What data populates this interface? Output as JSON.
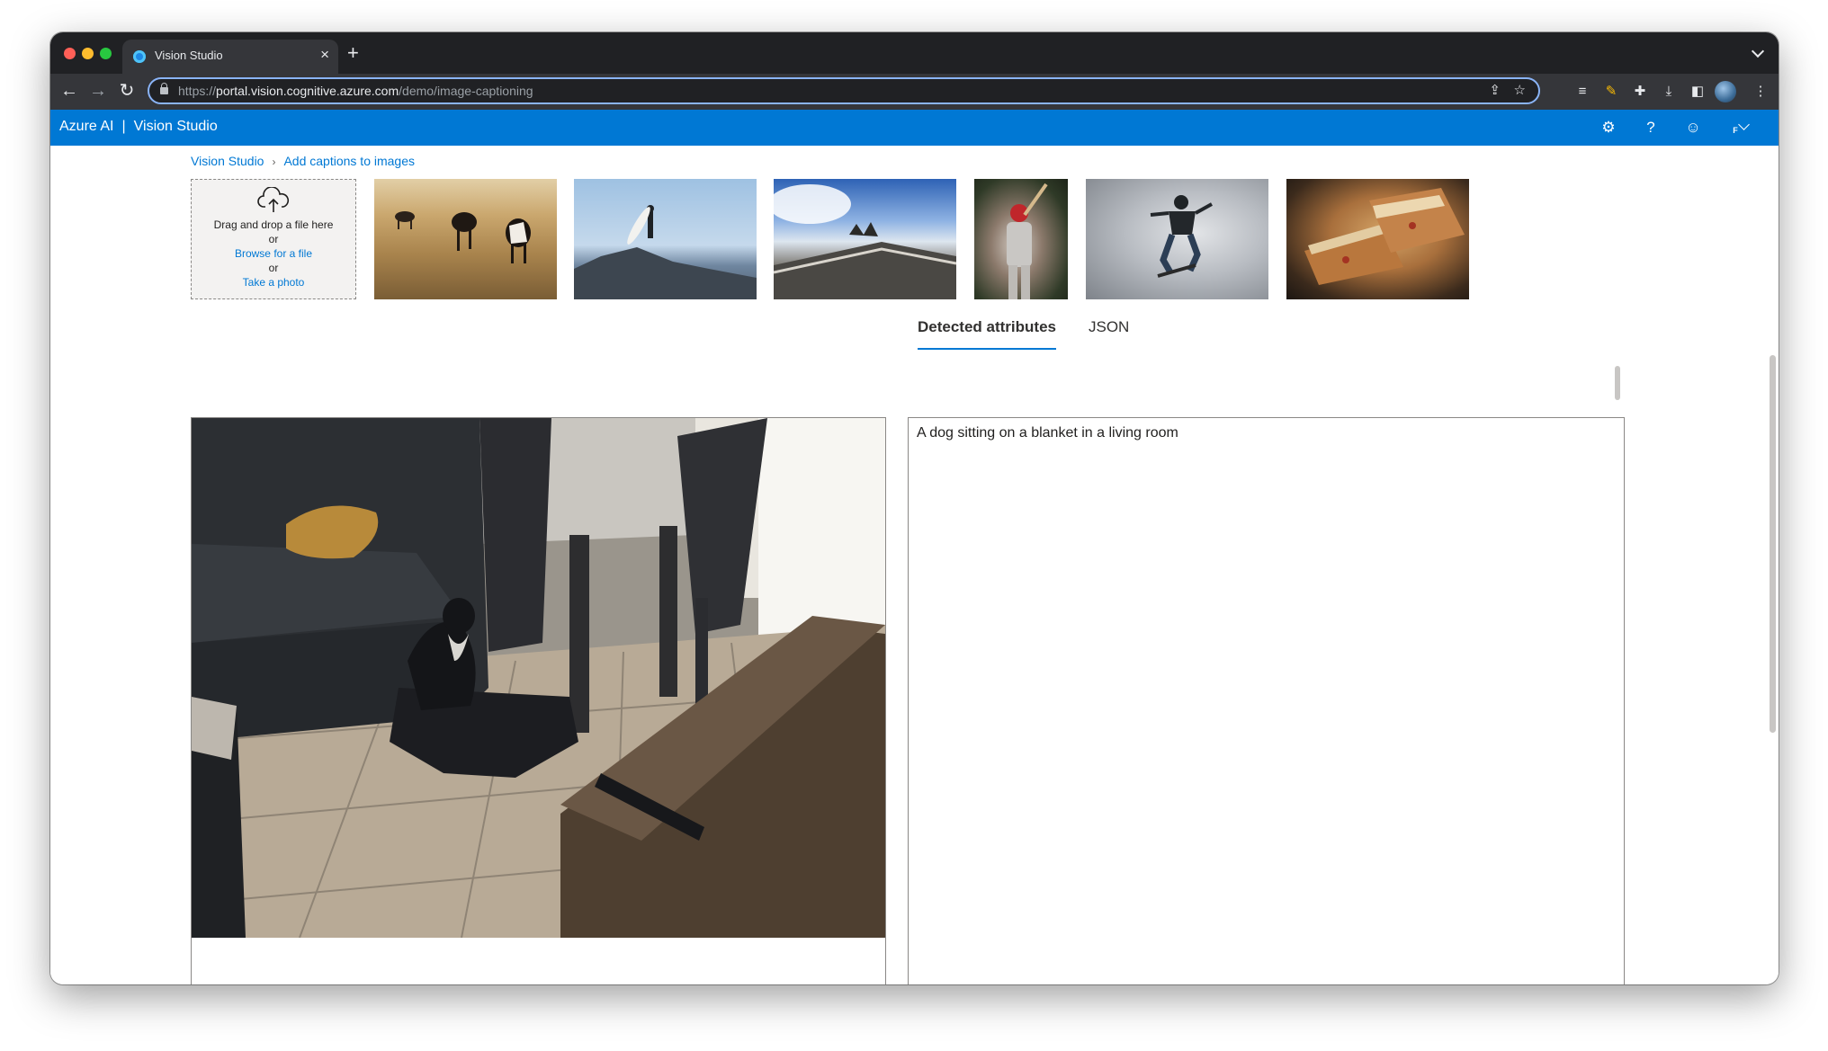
{
  "browser": {
    "tab_title": "Vision Studio",
    "tab_close": "×",
    "new_tab": "+",
    "url_prefix": "https://",
    "url_host": "portal.vision.cognitive.azure.com",
    "url_path": "/demo/image-captioning"
  },
  "header": {
    "brand": "Azure AI",
    "separator": "|",
    "product": "Vision Studio",
    "help": "?",
    "user_initial": "F"
  },
  "breadcrumb": {
    "root": "Vision Studio",
    "current": "Add captions to images"
  },
  "upload": {
    "drag_text": "Drag and drop a file here",
    "or_1": "or",
    "browse_link": "Browse for a file",
    "or_2": "or",
    "photo_link": "Take a photo"
  },
  "result_tabs": {
    "detected": "Detected attributes",
    "json": "JSON"
  },
  "result": {
    "caption": "A dog sitting on a blanket in a living room"
  },
  "colors": {
    "azure_blue": "#0078d4",
    "chrome_dark": "#202124",
    "chrome_toolbar": "#35363a",
    "omnibox_focus": "#8ab4f8"
  }
}
